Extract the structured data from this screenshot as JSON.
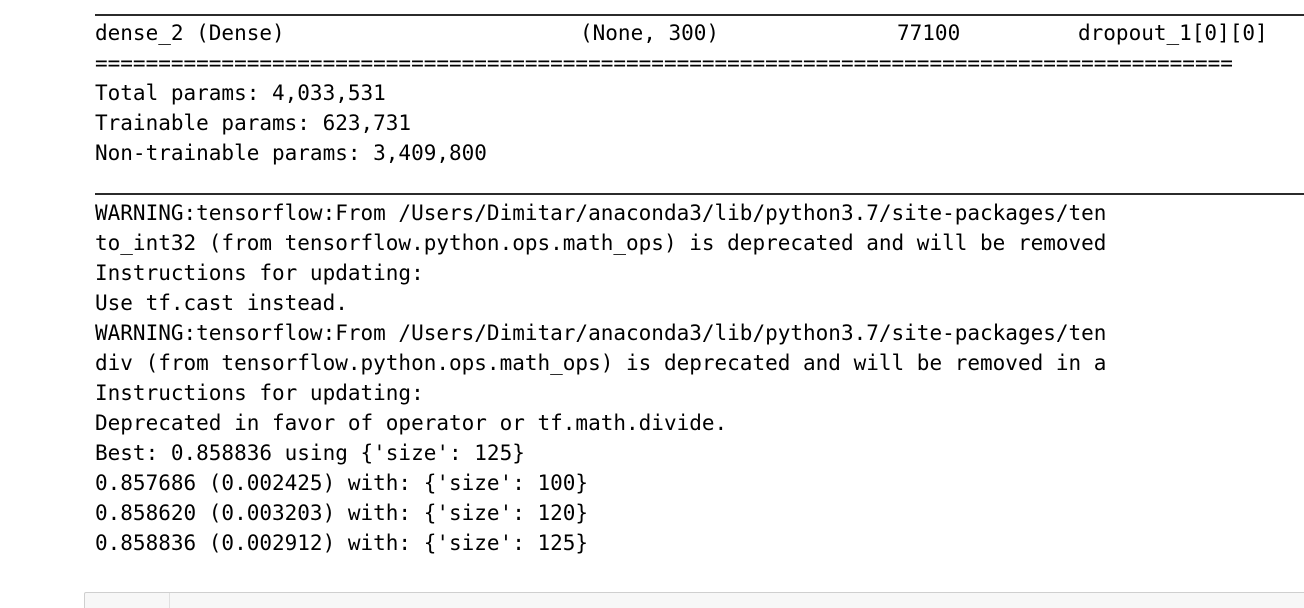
{
  "output": {
    "summary_row": {
      "layer": "dense_2 (Dense)",
      "output_shape": "(None, 300)",
      "param_count": "77100",
      "connected_to": "dropout_1[0][0]"
    },
    "double_rule": "==========================================================================================",
    "params": {
      "total": "Total params: 4,033,531",
      "trainable": "Trainable params: 623,731",
      "non_trainable": "Non-trainable params: 3,409,800"
    },
    "log_lines": [
      "WARNING:tensorflow:From /Users/Dimitar/anaconda3/lib/python3.7/site-packages/ten",
      "to_int32 (from tensorflow.python.ops.math_ops) is deprecated and will be removed",
      "Instructions for updating:",
      "Use tf.cast instead.",
      "WARNING:tensorflow:From /Users/Dimitar/anaconda3/lib/python3.7/site-packages/ten",
      "div (from tensorflow.python.ops.math_ops) is deprecated and will be removed in a",
      "Instructions for updating:",
      "Deprecated in favor of operator or tf.math.divide.",
      "Best: 0.858836 using {'size': 125}",
      "0.857686 (0.002425) with: {'size': 100}",
      "0.858620 (0.003203) with: {'size': 120}",
      "0.858836 (0.002912) with: {'size': 125}"
    ]
  }
}
